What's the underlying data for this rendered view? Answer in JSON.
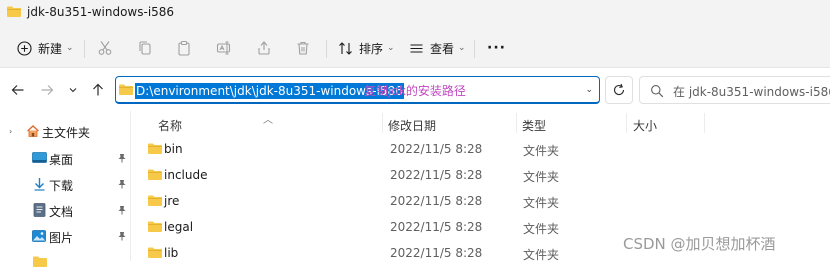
{
  "window": {
    "title": "jdk-8u351-windows-i586"
  },
  "toolbar": {
    "new_label": "新建",
    "sort_label": "排序",
    "view_label": "查看",
    "more_label": "···"
  },
  "address": {
    "path": "D:\\environment\\jdk\\jdk-8u351-windows-i586",
    "annotation": "复制jdk的安装路径"
  },
  "search": {
    "placeholder": "在 jdk-8u351-windows-i586 中搜索"
  },
  "sidebar": {
    "items": [
      {
        "label": "主文件夹",
        "icon": "home-icon",
        "pinned": false
      },
      {
        "label": "桌面",
        "icon": "desktop-icon",
        "pinned": true
      },
      {
        "label": "下载",
        "icon": "download-icon",
        "pinned": true
      },
      {
        "label": "文档",
        "icon": "documents-icon",
        "pinned": true
      },
      {
        "label": "图片",
        "icon": "pictures-icon",
        "pinned": true
      }
    ]
  },
  "columns": {
    "name": "名称",
    "date": "修改日期",
    "type": "类型",
    "size": "大小"
  },
  "files": [
    {
      "name": "bin",
      "date": "2022/11/5 8:28",
      "type": "文件夹"
    },
    {
      "name": "include",
      "date": "2022/11/5 8:28",
      "type": "文件夹"
    },
    {
      "name": "jre",
      "date": "2022/11/5 8:28",
      "type": "文件夹"
    },
    {
      "name": "legal",
      "date": "2022/11/5 8:28",
      "type": "文件夹"
    },
    {
      "name": "lib",
      "date": "2022/11/5 8:28",
      "type": "文件夹"
    }
  ],
  "watermark": "CSDN @加贝想加杯酒",
  "colors": {
    "folder": "#f7c948",
    "selection": "#0078d7",
    "accent_border": "#0067c0",
    "annotation": "#c04ac0"
  }
}
